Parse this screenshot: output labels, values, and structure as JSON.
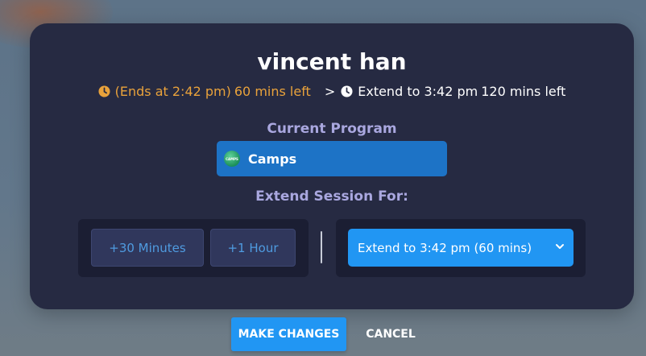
{
  "modal": {
    "title": "vincent han",
    "ends_text": "(Ends at 2:42 pm)",
    "mins_left": "60 mins left",
    "separator": ">",
    "extend_to_text": "Extend to 3:42 pm",
    "extended_mins_left": "120 mins left",
    "current_program_label": "Current Program",
    "program": {
      "name": "Camps",
      "logo_text": "CAMPS"
    },
    "extend_label": "Extend Session For:",
    "options": [
      {
        "label": "+30 Minutes"
      },
      {
        "label": "+1 Hour"
      }
    ],
    "select": {
      "value": "Extend to 3:42 pm (60 mins)"
    }
  },
  "actions": {
    "make_changes": "MAKE CHANGES",
    "cancel": "CANCEL"
  },
  "colors": {
    "modal_bg": "#262a42",
    "accent_blue": "#2196f3",
    "program_blue": "#1d73c6",
    "warning_orange": "#e9a23b",
    "label_lavender": "#a9a7df"
  }
}
